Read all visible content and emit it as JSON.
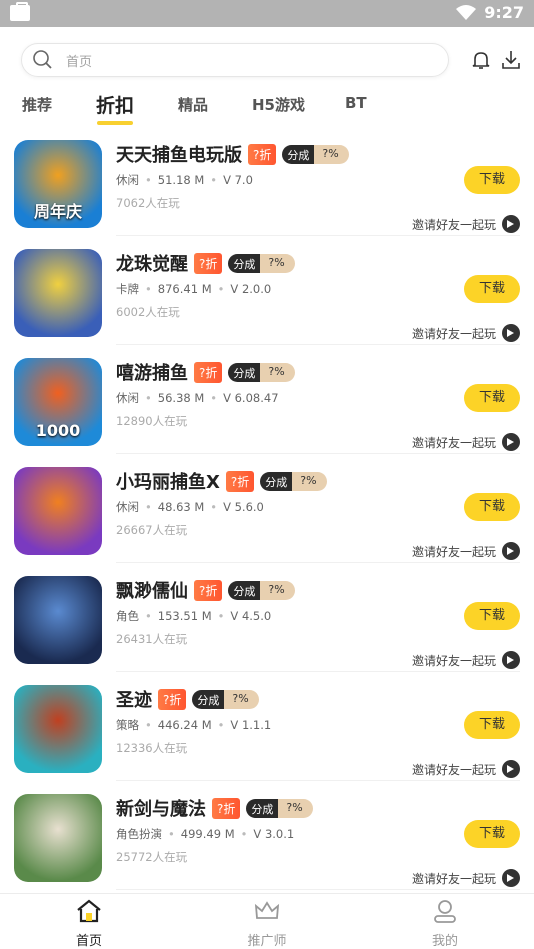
{
  "status": {
    "time": "9:27"
  },
  "search": {
    "placeholder": "首页"
  },
  "tabs": [
    {
      "label": "推荐"
    },
    {
      "label": "折扣",
      "active": true
    },
    {
      "label": "精品"
    },
    {
      "label": "H5游戏"
    },
    {
      "label": "BT"
    }
  ],
  "games": [
    {
      "name": "天天捕鱼电玩版",
      "discount": "?折",
      "share_a": "分成",
      "share_b": "?%",
      "genre": "休闲",
      "size": "51.18 M",
      "version": "V 7.0",
      "players": "7062人在玩",
      "download": "下载",
      "invite": "邀请好友一起玩",
      "thumb_text": "周年庆",
      "thumb_colors": [
        "#1a7fd4",
        "#f0a020"
      ]
    },
    {
      "name": "龙珠觉醒",
      "discount": "?折",
      "share_a": "分成",
      "share_b": "?%",
      "genre": "卡牌",
      "size": "876.41 M",
      "version": "V 2.0.0",
      "players": "6002人在玩",
      "download": "下载",
      "invite": "邀请好友一起玩",
      "thumb_text": "",
      "thumb_colors": [
        "#3a5fb8",
        "#f0d040"
      ]
    },
    {
      "name": "嘻游捕鱼",
      "discount": "?折",
      "share_a": "分成",
      "share_b": "?%",
      "genre": "休闲",
      "size": "56.38 M",
      "version": "V 6.08.47",
      "players": "12890人在玩",
      "download": "下载",
      "invite": "邀请好友一起玩",
      "thumb_text": "1000",
      "thumb_colors": [
        "#1e8ad8",
        "#f06020"
      ]
    },
    {
      "name": "小玛丽捕鱼X",
      "discount": "?折",
      "share_a": "分成",
      "share_b": "?%",
      "genre": "休闲",
      "size": "48.63 M",
      "version": "V 5.6.0",
      "players": "26667人在玩",
      "download": "下载",
      "invite": "邀请好友一起玩",
      "thumb_text": "",
      "thumb_colors": [
        "#7a3ac0",
        "#f08020"
      ]
    },
    {
      "name": "飘渺儒仙",
      "discount": "?折",
      "share_a": "分成",
      "share_b": "?%",
      "genre": "角色",
      "size": "153.51 M",
      "version": "V 4.5.0",
      "players": "26431人在玩",
      "download": "下载",
      "invite": "邀请好友一起玩",
      "thumb_text": "",
      "thumb_colors": [
        "#1a2a50",
        "#5a8ad0"
      ]
    },
    {
      "name": "圣迹",
      "discount": "?折",
      "share_a": "分成",
      "share_b": "?%",
      "genre": "策略",
      "size": "446.24 M",
      "version": "V 1.1.1",
      "players": "12336人在玩",
      "download": "下载",
      "invite": "邀请好友一起玩",
      "thumb_text": "",
      "thumb_colors": [
        "#2ab0c0",
        "#c04020"
      ]
    },
    {
      "name": "新剑与魔法",
      "discount": "?折",
      "share_a": "分成",
      "share_b": "?%",
      "genre": "角色扮演",
      "size": "499.49 M",
      "version": "V 3.0.1",
      "players": "25772人在玩",
      "download": "下载",
      "invite": "邀请好友一起玩",
      "thumb_text": "",
      "thumb_colors": [
        "#5a8a4a",
        "#e8e0d0"
      ]
    }
  ],
  "bottom_nav": [
    {
      "label": "首页",
      "active": true
    },
    {
      "label": "推广师"
    },
    {
      "label": "我的"
    }
  ],
  "colors": {
    "accent": "#fcd327",
    "status_bar": "#b3b3b3",
    "discount": "#ff5630"
  }
}
